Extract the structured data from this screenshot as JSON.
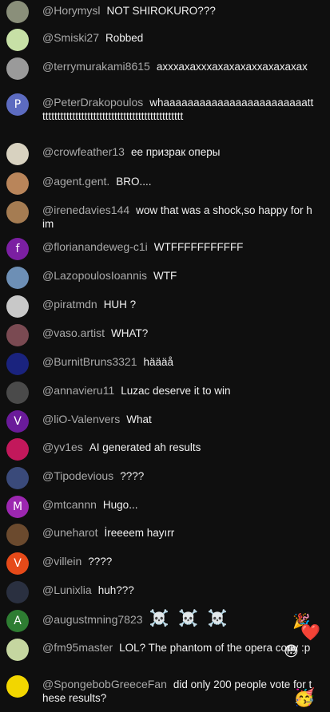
{
  "messages": [
    {
      "author": "@Horymysl",
      "text": "NOT SHIROKURO???",
      "avatar": {
        "bg": "#8a8f7a",
        "letter": ""
      }
    },
    {
      "author": "@Smiski27",
      "text": "Robbed",
      "avatar": {
        "bg": "#c7e0a6",
        "letter": ""
      }
    },
    {
      "author": "@terrymurakami8615",
      "text": "ахххахахххахахахаххахахахах",
      "avatar": {
        "bg": "#9a9a9a",
        "letter": ""
      }
    },
    {
      "author": "@PeterDrakopoulos",
      "text": "whaaaaaaaaaaaaaaaaaaaaaaaattttttttttttttttttttttttttttttttttttttttttttttttt",
      "avatar": {
        "bg": "#5c6bc0",
        "letter": "P"
      }
    },
    {
      "author": "@crowfeather13",
      "text": "ее призрак оперы",
      "avatar": {
        "bg": "#d8d2c0",
        "letter": ""
      }
    },
    {
      "author": "@agent.gent.",
      "text": "BRO....",
      "avatar": {
        "bg": "#b9855a",
        "letter": ""
      }
    },
    {
      "author": "@irenedavies144",
      "text": "wow that was a shock,so happy for him",
      "avatar": {
        "bg": "#a57c52",
        "letter": ""
      }
    },
    {
      "author": "@florianandeweg-c1i",
      "text": "WTFFFFFFFFFFF",
      "avatar": {
        "bg": "#7b1fa2",
        "letter": "f"
      }
    },
    {
      "author": "@LazopoulosIoannis",
      "text": "WTF",
      "avatar": {
        "bg": "#6d8fb5",
        "letter": ""
      }
    },
    {
      "author": "@piratmdn",
      "text": "HUH ?",
      "avatar": {
        "bg": "#c8c8c8",
        "letter": ""
      }
    },
    {
      "author": "@vaso.artist",
      "text": "WHAT?",
      "avatar": {
        "bg": "#7a4a52",
        "letter": ""
      }
    },
    {
      "author": "@BurnitBruns3321",
      "text": "häääå",
      "avatar": {
        "bg": "#1a237e",
        "letter": ""
      }
    },
    {
      "author": "@annavieru11",
      "text": "Luzac deserve it to win",
      "avatar": {
        "bg": "#4a4a4a",
        "letter": ""
      }
    },
    {
      "author": "@liO-Valenvers",
      "text": "What",
      "avatar": {
        "bg": "#6a1b9a",
        "letter": "V"
      }
    },
    {
      "author": "@yv1es",
      "text": "AI generated ah results",
      "avatar": {
        "bg": "#c2185b",
        "letter": ""
      }
    },
    {
      "author": "@Tipodevious",
      "text": "????",
      "avatar": {
        "bg": "#3a4a7a",
        "letter": ""
      }
    },
    {
      "author": "@mtcannn",
      "text": "Hugo...",
      "avatar": {
        "bg": "#9c27b0",
        "letter": "M"
      }
    },
    {
      "author": "@uneharot",
      "text": "İreeeem hayırr",
      "avatar": {
        "bg": "#6b4a2e",
        "letter": ""
      }
    },
    {
      "author": "@villein",
      "text": "????",
      "avatar": {
        "bg": "#e64a19",
        "letter": "V"
      }
    },
    {
      "author": "@Lunixlia",
      "text": "huh???",
      "avatar": {
        "bg": "#2a3040",
        "letter": ""
      }
    },
    {
      "author": "@augustmning7823",
      "text": "☠️ ☠️ ☠️",
      "avatar": {
        "bg": "#2e7d32",
        "letter": "A"
      }
    },
    {
      "author": "@fm95master",
      "text": "LOL? The phantom of the opera copy :p",
      "avatar": {
        "bg": "#c5d6a0",
        "letter": ""
      }
    },
    {
      "author": "@SpongebobGreeceFan",
      "text": "did only 200 people vote for these results?",
      "avatar": {
        "bg": "#f2d600",
        "letter": ""
      }
    }
  ],
  "reactions": [
    {
      "emoji": "🎉",
      "icon": "party-popper-icon"
    },
    {
      "emoji": "❤️",
      "icon": "heart-icon"
    },
    {
      "emoji": "😳",
      "icon": "flushed-face-icon"
    },
    {
      "emoji": "🥳",
      "icon": "partying-face-icon"
    }
  ]
}
